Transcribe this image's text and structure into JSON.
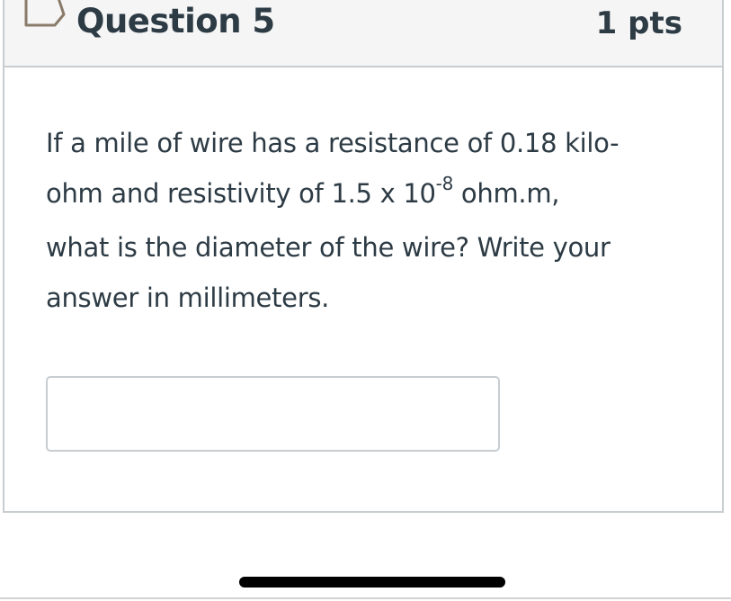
{
  "question": {
    "title": "Question 5",
    "points": "1 pts",
    "text_line1": "If a mile of wire has a resistance of 0.18 kilo-",
    "text_line2_before": "ohm and resistivity of  1.5 x 10",
    "text_line2_exponent": "-8",
    "text_line2_after": " ohm.m,",
    "text_line3": "what is the diameter of the wire? Write your",
    "text_line4": "answer in millimeters."
  },
  "answer": {
    "value": "",
    "placeholder": ""
  },
  "icons": {
    "flag": "bookmark-flag-icon"
  },
  "colors": {
    "text": "#2d3b45",
    "border": "#c7cdd1",
    "header_bg": "#f5f5f5"
  }
}
